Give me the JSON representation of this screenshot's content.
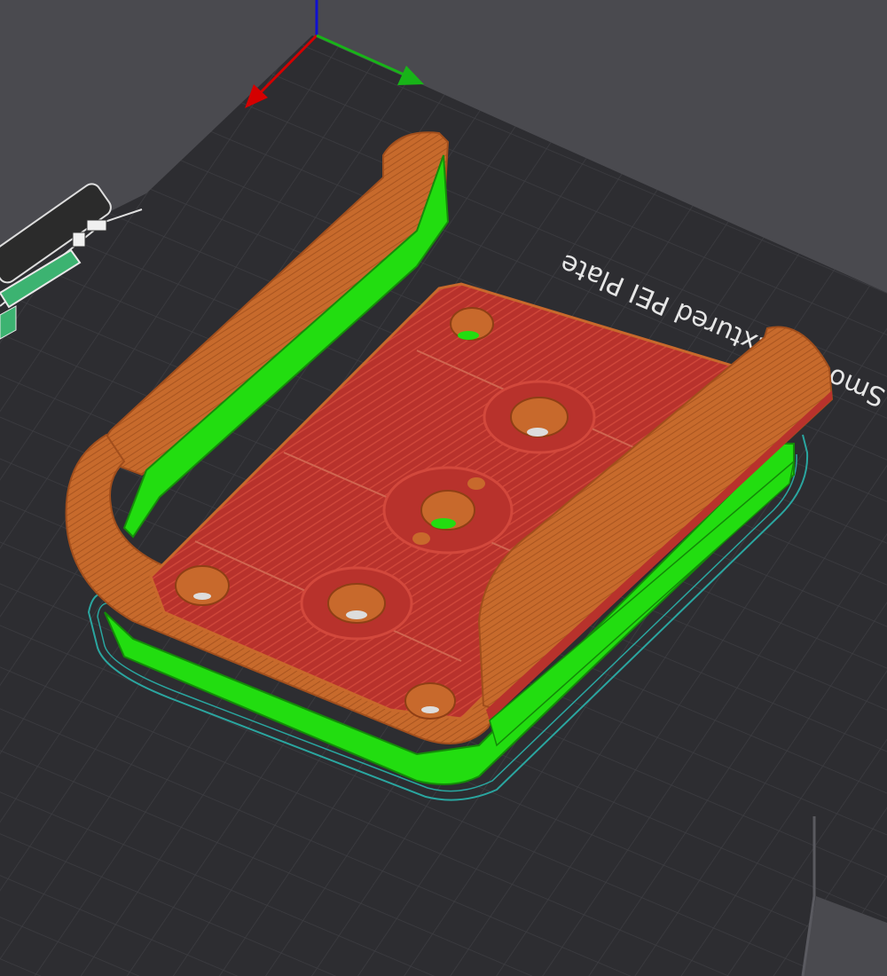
{
  "viewport": {
    "bed_label": "Smooth Textured PEI Plate"
  },
  "layer_slider": {
    "value": 1.0
  },
  "colors": {
    "background": "#4a4a4f",
    "bed": "#2d2d31",
    "grid": "#3f3f44",
    "model_wall": "#c8692c",
    "model_wall_dark": "#a8541f",
    "top_surface": "#b8322c",
    "support": "#22dd10",
    "skirt": "#2aa6a0",
    "axis_x": "#d40000",
    "axis_y": "#18b418",
    "axis_z": "#1010d0",
    "slider_track": "#3cb371"
  },
  "icons": {
    "axes": "xyz-axes-icon",
    "slider_handle": "layer-slider-handle-icon"
  }
}
